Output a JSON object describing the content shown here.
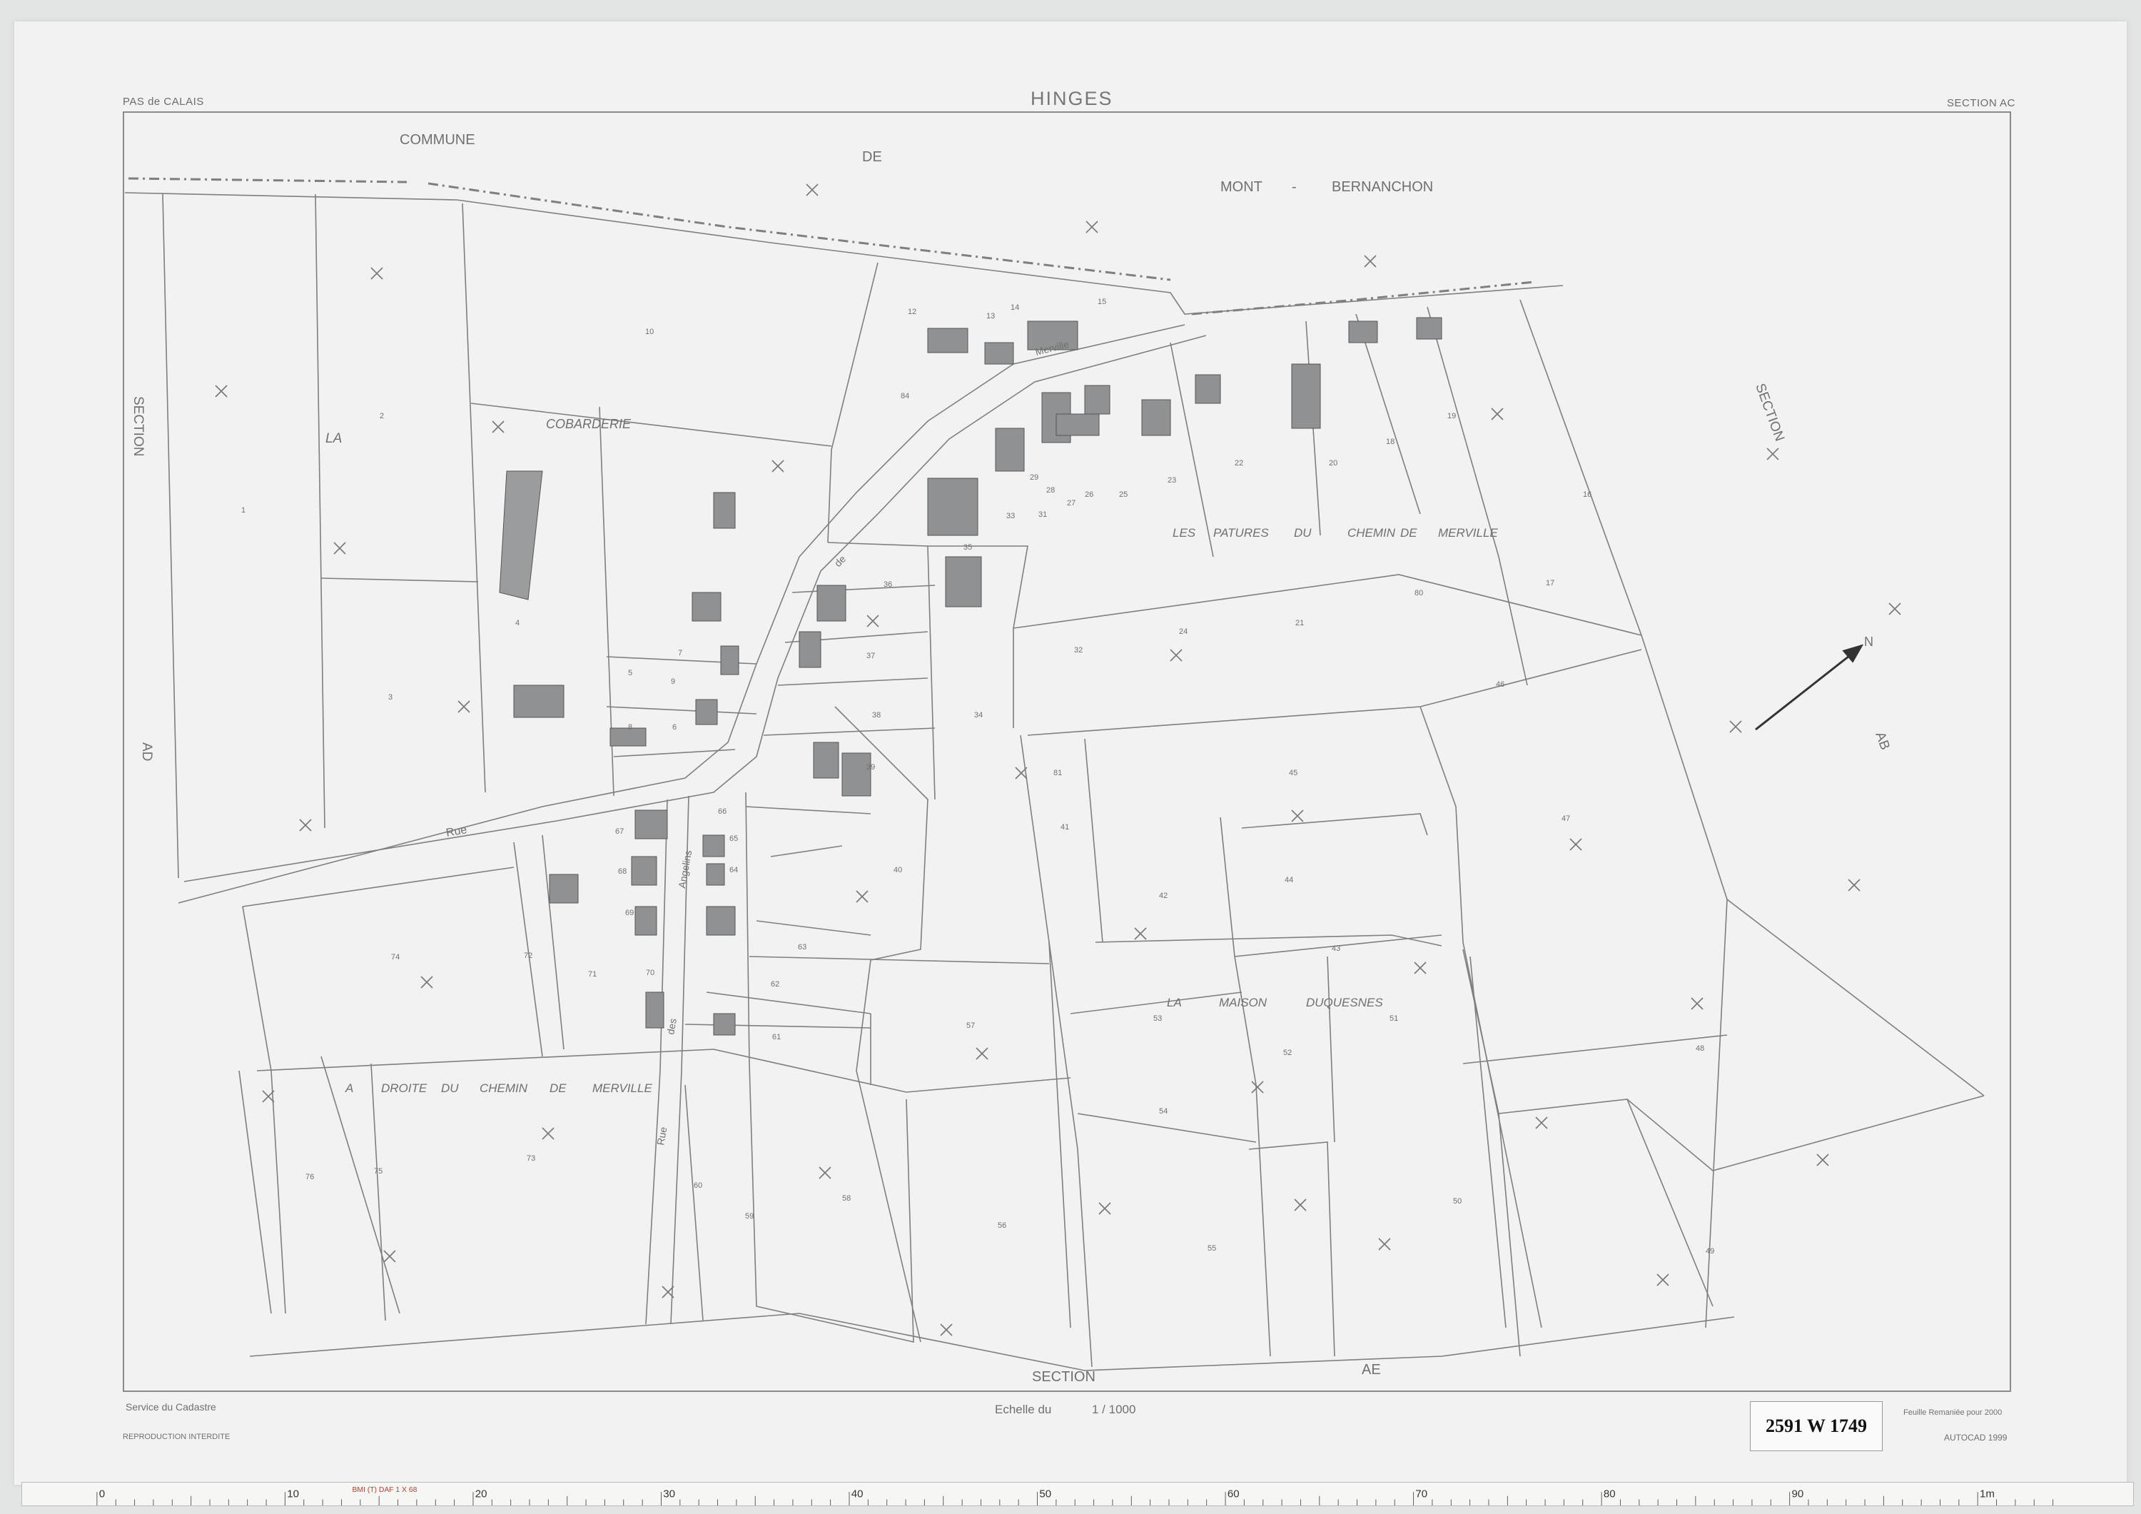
{
  "header": {
    "department": "PAS de CALAIS",
    "commune_title": "HINGES",
    "section": "SECTION AC"
  },
  "neighbours": {
    "top": [
      "COMMUNE",
      "DE",
      "MONT",
      "-",
      "BERNANCHON"
    ],
    "left": [
      "SECTION",
      "AD"
    ],
    "right": [
      "SECTION",
      "AB"
    ],
    "bottom": [
      "SECTION",
      "AE"
    ]
  },
  "place_names": {
    "la": "LA",
    "cobarderie": "COBARDERIE",
    "patures": [
      "LES",
      "PATURES",
      "DU",
      "CHEMIN",
      "DE",
      "MERVILLE"
    ],
    "maison": [
      "LA",
      "MAISON",
      "DUQUESNES"
    ],
    "droite": [
      "A",
      "DROITE",
      "DU",
      "CHEMIN",
      "DE",
      "MERVILLE"
    ]
  },
  "roads": {
    "rue": "Rue",
    "de": "de",
    "merville": "Merville",
    "angelins": "Angelins",
    "des": "des",
    "rue2": "Rue"
  },
  "parcel_numbers": [
    "1",
    "2",
    "3",
    "4",
    "5",
    "6",
    "7",
    "8",
    "9",
    "10",
    "12",
    "13",
    "14",
    "15",
    "16",
    "17",
    "18",
    "19",
    "20",
    "21",
    "22",
    "23",
    "24",
    "25",
    "26",
    "27",
    "28",
    "29",
    "31",
    "32",
    "33",
    "34",
    "35",
    "36",
    "37",
    "38",
    "39",
    "40",
    "41",
    "42",
    "43",
    "44",
    "45",
    "46",
    "47",
    "48",
    "49",
    "50",
    "51",
    "52",
    "53",
    "54",
    "55",
    "56",
    "57",
    "58",
    "59",
    "60",
    "61",
    "62",
    "63",
    "64",
    "65",
    "66",
    "67",
    "68",
    "69",
    "70",
    "71",
    "72",
    "73",
    "74",
    "75",
    "76",
    "80",
    "81",
    "84"
  ],
  "footer": {
    "service": "Service du Cadastre",
    "reproduction": "REPRODUCTION  INTERDITE",
    "scale_label": "Echelle du",
    "scale_value": "1 / 1000",
    "remaniee": "Feuille Remaniée pour 2000",
    "autocad": "AUTOCAD 1999",
    "archive_tag": "2591 W 1749"
  },
  "north_label": "N",
  "ruler": {
    "stamp": "BMI (T)  DAF 1 X 68",
    "marks": [
      "0",
      "10",
      "20",
      "30",
      "40",
      "50",
      "60",
      "70",
      "80",
      "90",
      "1m"
    ]
  },
  "colors": {
    "sheet": "#f1f2f1",
    "line": "#7d8080",
    "building": "#8f9192",
    "text": "#6f7171"
  }
}
